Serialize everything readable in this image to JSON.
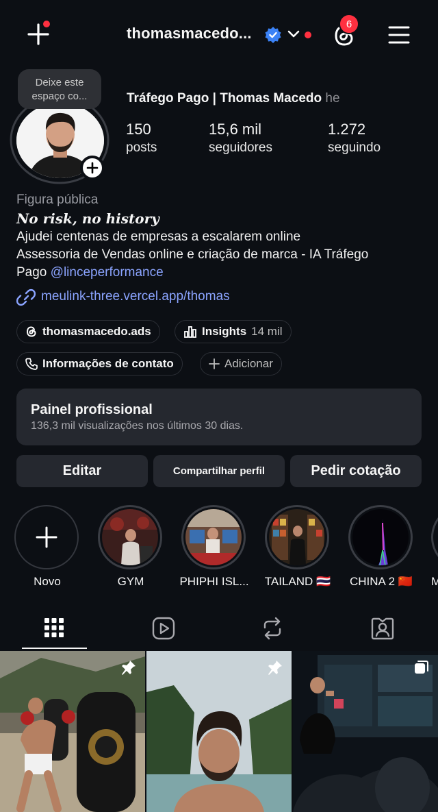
{
  "header": {
    "username": "thomasmacedo...",
    "threads_badge": "6",
    "icons": [
      "add-icon",
      "verified-icon",
      "chevron-down-icon",
      "threads-icon",
      "menu-icon"
    ]
  },
  "profile": {
    "note": "Deixe este espaço co...",
    "full_name": "Tráfego Pago | Thomas Macedo",
    "full_name_tail": "he",
    "stats": [
      {
        "num": "150",
        "label": "posts"
      },
      {
        "num": "15,6 mil",
        "label": "seguidores"
      },
      {
        "num": "1.272",
        "label": "seguindo"
      }
    ],
    "category": "Figura pública",
    "motto": "No risk, no history",
    "bio_line1": "Ajudei centenas de empresas a escalarem online",
    "bio_line2": "Assessoria de Vendas online e criação de marca - IA Tráfego",
    "bio_line3_prefix": "Pago",
    "bio_mention": "@linceperformance",
    "link": "meulink-three.vercel.app/thomas"
  },
  "chips": {
    "threads": "thomasmacedo.ads",
    "insights": "Insights",
    "insights_count": "14 mil",
    "contact": "Informações de contato",
    "add": "Adicionar"
  },
  "panel": {
    "title": "Painel profissional",
    "subtitle": "136,3 mil visualizações nos últimos 30 dias."
  },
  "actions": {
    "edit": "Editar",
    "share": "Compartilhar perfil",
    "quote": "Pedir cotação"
  },
  "highlights": [
    {
      "label": "Novo"
    },
    {
      "label": "GYM"
    },
    {
      "label": "PHIPHI ISL..."
    },
    {
      "label": "TAILAND 🇹🇭"
    },
    {
      "label": "CHINA 2 🇨🇳"
    },
    {
      "label": "M"
    }
  ],
  "tabs": [
    "grid-icon",
    "reels-icon",
    "reposts-icon",
    "tagged-icon"
  ],
  "colors": {
    "background": "#0c0f14",
    "surface": "#25282f",
    "link": "#8ba4ff",
    "verified": "#3b82f6",
    "notification": "#ff3040"
  }
}
